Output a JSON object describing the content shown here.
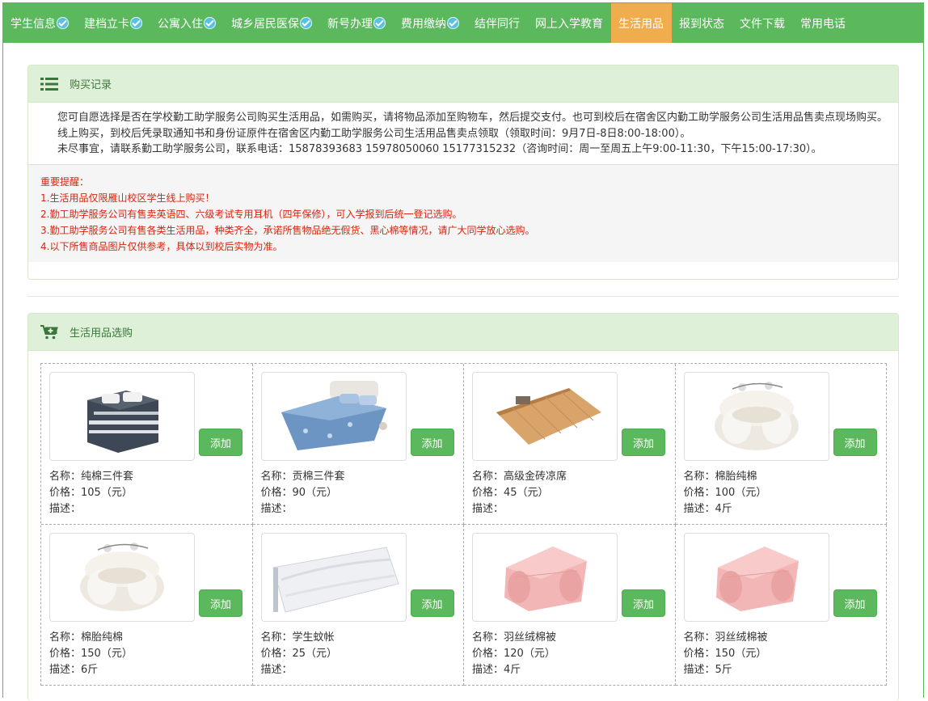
{
  "nav": [
    {
      "label": "学生信息",
      "checked": true,
      "active": false
    },
    {
      "label": "建档立卡",
      "checked": true,
      "active": false
    },
    {
      "label": "公寓入住",
      "checked": true,
      "active": false
    },
    {
      "label": "城乡居民医保",
      "checked": true,
      "active": false
    },
    {
      "label": "新号办理",
      "checked": true,
      "active": false
    },
    {
      "label": "费用缴纳",
      "checked": true,
      "active": false
    },
    {
      "label": "结伴同行",
      "checked": false,
      "active": false
    },
    {
      "label": "网上入学教育",
      "checked": false,
      "active": false
    },
    {
      "label": "生活用品",
      "checked": false,
      "active": true
    },
    {
      "label": "报到状态",
      "checked": false,
      "active": false
    },
    {
      "label": "文件下载",
      "checked": false,
      "active": false
    },
    {
      "label": "常用电话",
      "checked": false,
      "active": false
    }
  ],
  "purchase": {
    "title": "购买记录",
    "paragraphs": [
      "您可自愿选择是否在学校勤工助学服务公司购买生活用品，如需购买，请将物品添加至购物车，然后提交支付。也可到校后在宿舍区内勤工助学服务公司生活用品售卖点现场购买。",
      "线上购买，到校后凭录取通知书和身份证原件在宿舍区内勤工助学服务公司生活用品售卖点领取（领取时间：9月7日-8日8:00-18:00）。",
      "未尽事宜，请联系勤工助学服务公司，联系电话：15878393683 15978050060 15177315232（咨询时间：周一至周五上午9:00-11:30，下午15:00-17:30）。"
    ],
    "warnings": [
      "重要提醒：",
      "1.生活用品仅限雁山校区学生线上购买！",
      "2.勤工助学服务公司有售卖英语四、六级考试专用耳机（四年保修），可入学报到后统一登记选购。",
      "3.勤工助学服务公司有售各类生活用品，种类齐全，承诺所售物品绝无假货、黑心棉等情况，请广大同学放心选购。",
      "4.以下所售商品图片仅供参考，具体以到校后实物为准。"
    ]
  },
  "shop": {
    "title": "生活用品选购",
    "add_label": "添加",
    "products": [
      {
        "name": "名称：纯棉三件套",
        "price": "价格：105（元）",
        "desc": "描述：",
        "image": "bedding-set-gray"
      },
      {
        "name": "名称：贡棉三件套",
        "price": "价格：90（元）",
        "desc": "描述：",
        "image": "bedding-set-blue"
      },
      {
        "name": "名称：高级金砖凉席",
        "price": "价格：45（元）",
        "desc": "描述：",
        "image": "bamboo-mat"
      },
      {
        "name": "名称：棉胎纯棉",
        "price": "价格：100（元）",
        "desc": "描述：4斤",
        "image": "cotton-quilt"
      },
      {
        "name": "名称：棉胎纯棉",
        "price": "价格：150（元）",
        "desc": "描述：6斤",
        "image": "cotton-quilt"
      },
      {
        "name": "名称：学生蚊帐",
        "price": "价格：25（元）",
        "desc": "描述：",
        "image": "mosquito-net"
      },
      {
        "name": "名称：羽丝绒棉被",
        "price": "价格：120（元）",
        "desc": "描述：4斤",
        "image": "pink-duvet"
      },
      {
        "name": "名称：羽丝绒棉被",
        "price": "价格：150（元）",
        "desc": "描述：5斤",
        "image": "pink-duvet"
      }
    ]
  },
  "colors": {
    "nav_bg": "#5cb85c",
    "nav_active": "#f0ad4e",
    "check": "#5bc0de",
    "warning": "#d9230f"
  }
}
